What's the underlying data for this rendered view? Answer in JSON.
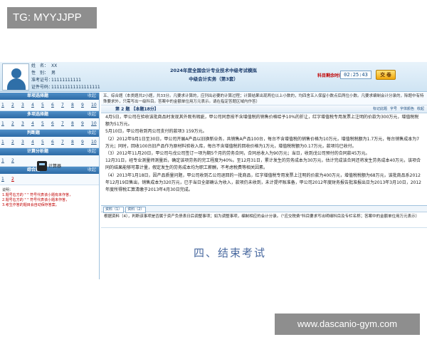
{
  "watermark_tag": "TG: MYYJJPP",
  "watermark_site": "www.dascanio-gym.com",
  "header": {
    "info": [
      {
        "key": "姓　名：",
        "value": "XX"
      },
      {
        "key": "性　别：",
        "value": "男"
      },
      {
        "key": "准考证号：",
        "value": "11111111111"
      },
      {
        "key": "证件号码：",
        "value": "111111111111111111"
      }
    ],
    "title_line1": "2024年度全国会计专业技术中级考试模拟",
    "title_line2": "中级会计实务（第3套）",
    "timer_label": "科目剩余时间：",
    "timer": "02:25:43",
    "submit_label": "交 卷"
  },
  "sidebar": {
    "collapse_label": "收起",
    "sections": [
      {
        "title": "单项选择题",
        "items": [
          "1",
          "2",
          "3",
          "4",
          "5",
          "6",
          "7",
          "8",
          "9",
          "10"
        ]
      },
      {
        "title": "多项选择题",
        "items": [
          "1",
          "2",
          "3",
          "4",
          "5",
          "6",
          "7",
          "8",
          "9",
          "10"
        ]
      },
      {
        "title": "判断题",
        "items": [
          "1",
          "2",
          "3",
          "4",
          "5",
          "6",
          "7",
          "8",
          "9",
          "10"
        ]
      },
      {
        "title": "计算分析题",
        "items": [
          "1",
          "2"
        ]
      },
      {
        "title": "综合题",
        "items": [
          "1",
          "2"
        ]
      }
    ],
    "legend_title": "说明：",
    "legend_lines": [
      "1.题号右方的 \" \" 符号代表该小题有未作答，",
      "2.题号右方的 \" \" 符号代表该小题未作答，",
      "3.考生作答的题目会自动保存答案。"
    ],
    "calculator_label": "计算器"
  },
  "main": {
    "instructions": "五、综合题（本类题共2小题，共33分。凡要求计算的，应列出必要的计算过程；计算结果出现两位以上小数的，均四舍五入保留小数点后两位小数。凡要求编制会计分录的，除题中有特殊要求外，只需写出一级科目。答案中的金额单位用万元表示。请在指定答题区域内作答）",
    "question_label": "第 2 题  【本题18分】",
    "tools": [
      "标记此题",
      "字号",
      "字体颜色",
      "收起"
    ],
    "paragraphs": [
      "4月5日，甲公司在验收该批商品时发现其外观有瑕疵，甲公司同意按不含增值税的销售价格给予10%的折让，红字增值税专用发票上注明的价款为300万元，增值税税额为51万元。",
      "5月10日，甲公司收到丙公司支付的款项3 159万元。",
      "（2）2012年9月1日至30日，甲公司开展A产品以旧换新业务，共销售A产品100台，每台不含增值税的销售价格为10万元，增值税税额为1.7万元，每台销售成本为7万元；同时，回收100台旧产品作为原材料验收入库，每台不含增值税的回收价格为1万元，增值税税额为0.17万元，款项均已收付。",
      "（3）2012年11月20日，甲公司与戊公司签订一项为期5个月的劳务合同，合同总收入为90万元；当日，收到戊公司预付的合同款45万元。",
      "12月31日，经专业测量师测量后，确定该项劳务的完工程度为40%。至12月31日，累计发生的劳务成本为30万元，估计完成该合同还将发生劳务成本40万元，该项合同的结果能够可靠计量，假定发生的劳务成本均为职工薪酬，不考虑税费等相关因素。",
      "（4）2013年1月18日，因产品质量问题，甲公司收到乙公司退回的一批商品，红字增值税专用发票上注明的价款为400万元，增值税税额为68万元，该批商品系2012年12月19日售出，销售成本为320万元，已于当日全部确认为收入，款项仍未收到，未计提坏账准备，甲公司2012年度财务报告批准报出日为2013年3月10日，2012年度所得税汇算清缴于2013年4月30日完成。"
    ],
    "material_buttons": [
      "资料（1）",
      "资料（2）"
    ],
    "answer_prompt": "根据资料（4），判断该事项是否属于资产负债表日后调整事项；如为调整事项，编制相应的会计分录。（\"应交税费\"科目要求写出明细科目及专栏名称；答案中的金额单位用万元表示）",
    "end_text": "四、结束考试"
  }
}
